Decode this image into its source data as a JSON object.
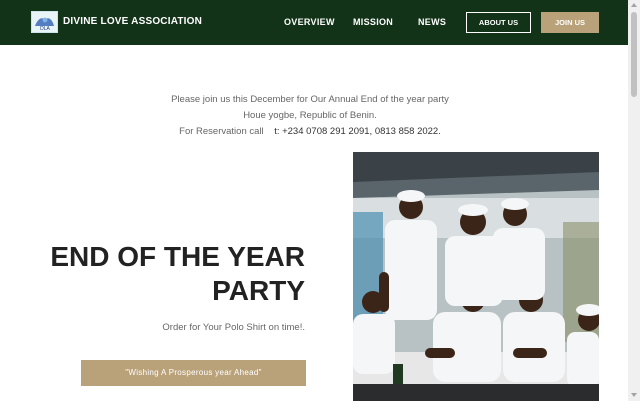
{
  "header": {
    "brand": "DIVINE LOVE ASSOCIATION",
    "nav": [
      {
        "label": "OVERVIEW"
      },
      {
        "label": "MISSION"
      },
      {
        "label": "NEWS"
      }
    ],
    "about_label": "ABOUT US",
    "join_label": "JOIN US"
  },
  "intro": {
    "line1": "Please join us this December for Our Annual End of the year party",
    "line2": "Houe yogbe, Republic of Benin.",
    "line3_prefix": "For Reservation call",
    "line3_phone": "t: +234 0708 291 2091, 0813 858 2022."
  },
  "hero": {
    "title_line1": "END OF THE YEAR",
    "title_line2": "PARTY",
    "subtitle": "Order for Your Polo Shirt on time!.",
    "cta_label": "\"Wishing A Prosperous year Ahead\""
  },
  "colors": {
    "nav_bg": "#123318",
    "accent": "#b9a27a"
  }
}
